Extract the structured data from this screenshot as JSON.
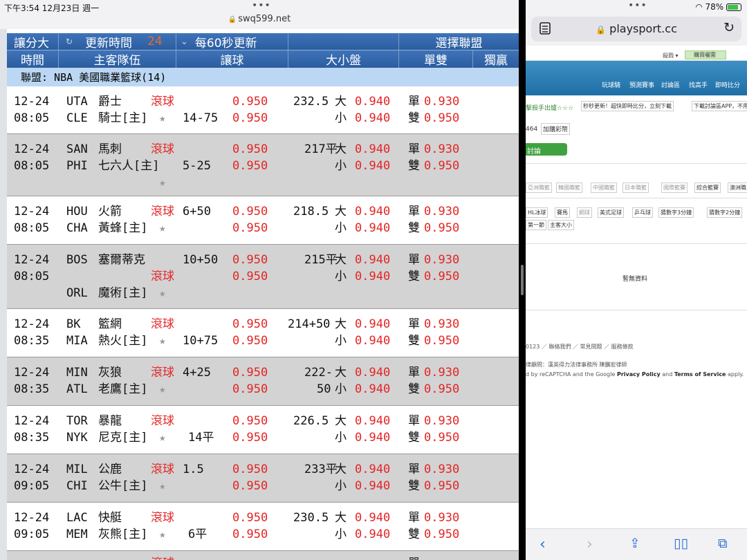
{
  "left": {
    "status": {
      "time": "下午3:54",
      "date": "12月23日 週一",
      "dots": "•••",
      "url": "swq599.net"
    },
    "header1": {
      "sort": "讓分大",
      "refresh_icon": "↻",
      "update_time_label": "更新時間",
      "countdown": "24",
      "dropdown_icon": "⌄",
      "refresh_rate": "每60秒更新",
      "choose_league": "選擇聯盟"
    },
    "header2": {
      "time": "時間",
      "teams": "主客隊伍",
      "spread": "讓球",
      "ou": "大小盤",
      "oddeven": "單雙",
      "moneyline": "獨贏"
    },
    "league": "聯盟: NBA 美國職業籃球(14)",
    "games": [
      {
        "date": "12-24",
        "time": "08:05",
        "away_code": "UTA",
        "away_name": "爵士",
        "home_code": "CLE",
        "home_name": "騎士[主]",
        "live": "滾球",
        "spread_line": "14-75",
        "spread_odds_away": "0.950",
        "spread_odds_home": "0.950",
        "ou_line": "232.5",
        "ou_over": "大",
        "ou_under": "小",
        "ou_odds_over": "0.940",
        "ou_odds_under": "0.940",
        "odd": "單",
        "even": "雙",
        "odd_odds": "0.930",
        "even_odds": "0.950"
      },
      {
        "date": "12-24",
        "time": "08:05",
        "away_code": "SAN",
        "away_name": "馬刺",
        "home_code": "PHI",
        "home_name": "七六人[主]",
        "live": "滾球",
        "spread_line": "5-25",
        "spread_odds_away": "0.950",
        "spread_odds_home": "0.950",
        "ou_line": "217平",
        "ou_over": "大",
        "ou_under": "小",
        "ou_odds_over": "0.940",
        "ou_odds_under": "0.940",
        "odd": "單",
        "even": "雙",
        "odd_odds": "0.930",
        "even_odds": "0.950"
      },
      {
        "date": "12-24",
        "time": "08:05",
        "away_code": "HOU",
        "away_name": "火箭",
        "home_code": "CHA",
        "home_name": "黃蜂[主]",
        "live": "滾球",
        "spread_line": "6+50",
        "spread_odds_away": "0.950",
        "spread_odds_home": "0.950",
        "ou_line": "218.5",
        "ou_over": "大",
        "ou_under": "小",
        "ou_odds_over": "0.940",
        "ou_odds_under": "0.940",
        "odd": "單",
        "even": "雙",
        "odd_odds": "0.930",
        "even_odds": "0.950"
      },
      {
        "date": "12-24",
        "time": "08:05",
        "away_code": "BOS",
        "away_name": "塞爾蒂克",
        "home_code": "ORL",
        "home_name": "魔術[主]",
        "live": "滾球",
        "spread_line": "10+50",
        "spread_odds_away": "0.950",
        "spread_odds_home": "0.950",
        "ou_line": "215平",
        "ou_over": "大",
        "ou_under": "小",
        "ou_odds_over": "0.940",
        "ou_odds_under": "0.940",
        "odd": "單",
        "even": "雙",
        "odd_odds": "0.930",
        "even_odds": "0.950"
      },
      {
        "date": "12-24",
        "time": "08:35",
        "away_code": "BK",
        "away_name": "籃網",
        "home_code": "MIA",
        "home_name": "熱火[主]",
        "live": "滾球",
        "spread_line": "10+75",
        "spread_odds_away": "0.950",
        "spread_odds_home": "0.950",
        "ou_line": "214+50",
        "ou_over": "大",
        "ou_under": "小",
        "ou_odds_over": "0.940",
        "ou_odds_under": "0.940",
        "odd": "單",
        "even": "雙",
        "odd_odds": "0.930",
        "even_odds": "0.950"
      },
      {
        "date": "12-24",
        "time": "08:35",
        "away_code": "MIN",
        "away_name": "灰狼",
        "home_code": "ATL",
        "home_name": "老鷹[主]",
        "live": "滾球",
        "spread_line": "4+25",
        "spread_odds_away": "0.950",
        "spread_odds_home": "0.950",
        "ou_line": "222-",
        "ou_line2": "50",
        "ou_over": "大",
        "ou_under": "小",
        "ou_odds_over": "0.940",
        "ou_odds_under": "0.940",
        "odd": "單",
        "even": "雙",
        "odd_odds": "0.930",
        "even_odds": "0.950"
      },
      {
        "date": "12-24",
        "time": "08:35",
        "away_code": "TOR",
        "away_name": "暴龍",
        "home_code": "NYK",
        "home_name": "尼克[主]",
        "live": "滾球",
        "spread_line": "14平",
        "spread_odds_away": "0.950",
        "spread_odds_home": "0.950",
        "ou_line": "226.5",
        "ou_over": "大",
        "ou_under": "小",
        "ou_odds_over": "0.940",
        "ou_odds_under": "0.940",
        "odd": "單",
        "even": "雙",
        "odd_odds": "0.930",
        "even_odds": "0.950"
      },
      {
        "date": "12-24",
        "time": "09:05",
        "away_code": "MIL",
        "away_name": "公鹿",
        "home_code": "CHI",
        "home_name": "公牛[主]",
        "live": "滾球",
        "spread_line": "1.5",
        "spread_odds_away": "0.950",
        "spread_odds_home": "0.950",
        "ou_line": "233平",
        "ou_over": "大",
        "ou_under": "小",
        "ou_odds_over": "0.940",
        "ou_odds_under": "0.940",
        "odd": "單",
        "even": "雙",
        "odd_odds": "0.930",
        "even_odds": "0.950"
      },
      {
        "date": "12-24",
        "time": "09:05",
        "away_code": "LAC",
        "away_name": "快艇",
        "home_code": "MEM",
        "home_name": "灰熊[主]",
        "live": "滾球",
        "spread_line": "6平",
        "spread_odds_away": "0.950",
        "spread_odds_home": "0.950",
        "ou_line": "230.5",
        "ou_over": "大",
        "ou_under": "小",
        "ou_odds_over": "0.940",
        "ou_odds_under": "0.940",
        "odd": "單",
        "even": "雙",
        "odd_odds": "0.930",
        "even_odds": "0.950"
      }
    ],
    "partial_row": {
      "live": "滾球",
      "odd": "單"
    }
  },
  "right": {
    "status": {
      "dots": "•••",
      "battery": "78%"
    },
    "address": {
      "domain": "playsport.cc"
    },
    "nav1": {
      "item1": "殺戮 ▾",
      "item2": "購買曬需"
    },
    "nav2": [
      "玩球騎",
      "預測賽事",
      "討論區",
      "找高手",
      "即時比分"
    ],
    "banners": [
      "擊殺手出爐☆☆☆",
      "秒秒更新！超快即時比分，立刻下載",
      "下載討論區APP，不用"
    ],
    "coins": "464",
    "buy_coins": "加購彩幣",
    "discuss": "討論",
    "leagues1": [
      "亞洲職籃",
      "韓國職籃",
      "中國職籃",
      "日本職籃",
      "國際籃賽",
      "綜合籃賽",
      "澳洲職"
    ],
    "leagues2": [
      "HL冰球",
      "賽馬",
      "網球",
      "美式足球",
      "乒乓球",
      "猜數字3分鐘",
      "猜數字2分鐘"
    ],
    "leagues3": [
      "第一節",
      "主客大小"
    ],
    "empty": "暫無資料",
    "footer_year": "0123",
    "footer_links": [
      "聯絡我們",
      "常見問題",
      "服務條款"
    ],
    "legal": "律顧問：漢英得力法律事務所 陳鵬宏律師",
    "recaptcha_prefix": "d by reCAPTCHA and the Google ",
    "privacy": "Privacy Policy",
    "and": " and ",
    "terms": "Terms of Service",
    "apply": " apply."
  }
}
